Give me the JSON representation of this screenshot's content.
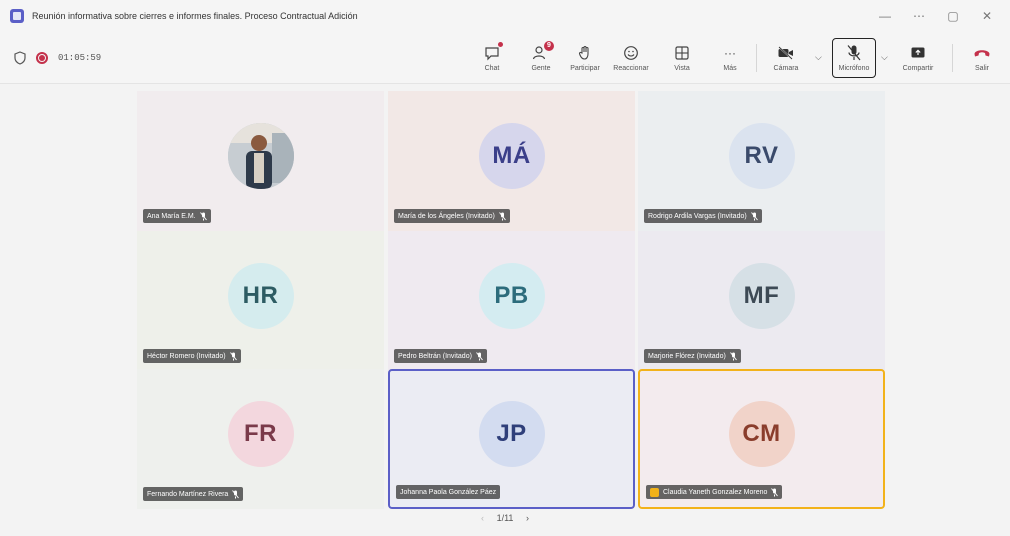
{
  "window": {
    "title": "Reunión informativa sobre cierres e informes finales. Proceso Contractual Adición",
    "controls": [
      "—",
      "⋯",
      "▢",
      "✕"
    ]
  },
  "status": {
    "timer": "01:05:59"
  },
  "toolbar": {
    "chat": "Chat",
    "people": "Gente",
    "people_count": "9",
    "raise": "Participar",
    "react": "Reaccionar",
    "view": "Vista",
    "more": "Más",
    "camera": "Cámara",
    "mic": "Micrófono",
    "share": "Compartir",
    "leave": "Salir"
  },
  "tiles": [
    {
      "initials": "",
      "name": "Ana María E.M.",
      "photo": true,
      "bg": "#f1ecee",
      "color": "#ffffff",
      "ring": ""
    },
    {
      "initials": "MÁ",
      "name": "María de los Ángeles (Invitado)",
      "bg": "#f2e8e6",
      "avatar_bg": "#d6d6ec",
      "color": "#3b3f8a",
      "ring": ""
    },
    {
      "initials": "RV",
      "name": "Rodrigo Ardila Vargas (Invitado)",
      "bg": "#ebeef0",
      "avatar_bg": "#dbe3ef",
      "color": "#3a4a6b",
      "ring": ""
    },
    {
      "initials": "HR",
      "name": "Héctor Romero (Invitado)",
      "bg": "#eef0ea",
      "avatar_bg": "#d5ecee",
      "color": "#2d5c63",
      "ring": ""
    },
    {
      "initials": "PB",
      "name": "Pedro Beltrán (Invitado)",
      "bg": "#efeaf0",
      "avatar_bg": "#d4ecf1",
      "color": "#2c6c7c",
      "ring": ""
    },
    {
      "initials": "MF",
      "name": "Marjorie Flórez (Invitado)",
      "bg": "#eceaf0",
      "avatar_bg": "#d6e0e6",
      "color": "#3d4a55",
      "ring": ""
    },
    {
      "initials": "FR",
      "name": "Fernando Martínez Rivera",
      "bg": "#eef0ed",
      "avatar_bg": "#f3d7de",
      "color": "#7a3a4a",
      "ring": ""
    },
    {
      "initials": "JP",
      "name": "Johanna Paola González Páez",
      "bg": "#ebecf3",
      "avatar_bg": "#d3dcf0",
      "color": "#2f3f7a",
      "ring": "#5b5fc7"
    },
    {
      "initials": "CM",
      "name": "Claudia Yaneth Gonzalez Moreno",
      "bg": "#f3ebee",
      "avatar_bg": "#f1d3c9",
      "color": "#8a3d2c",
      "ring": "#f2b21a",
      "hand": true
    }
  ],
  "pager": {
    "prev": "‹",
    "label": "1/11",
    "next": "›"
  }
}
